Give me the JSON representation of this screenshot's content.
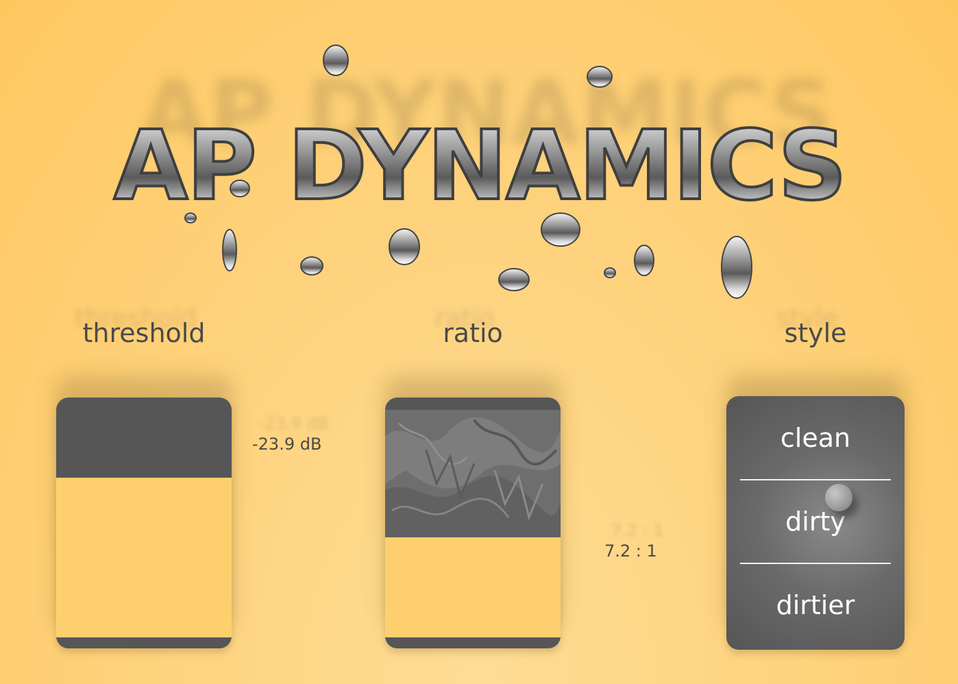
{
  "app": {
    "title": "AP DYNAMICS"
  },
  "controls": {
    "threshold": {
      "label": "threshold",
      "readout": "-23.9 dB",
      "fill_fraction": 0.7
    },
    "ratio": {
      "label": "ratio",
      "readout": "7.2 : 1",
      "fill_fraction": 0.42
    },
    "style": {
      "label": "style",
      "options": [
        "clean",
        "dirty",
        "dirtier"
      ],
      "selected": "dirty"
    }
  },
  "colors": {
    "background": "#fed17a",
    "panel": "#565656",
    "fill": "#fed06d",
    "text": "#4a4a4a"
  }
}
